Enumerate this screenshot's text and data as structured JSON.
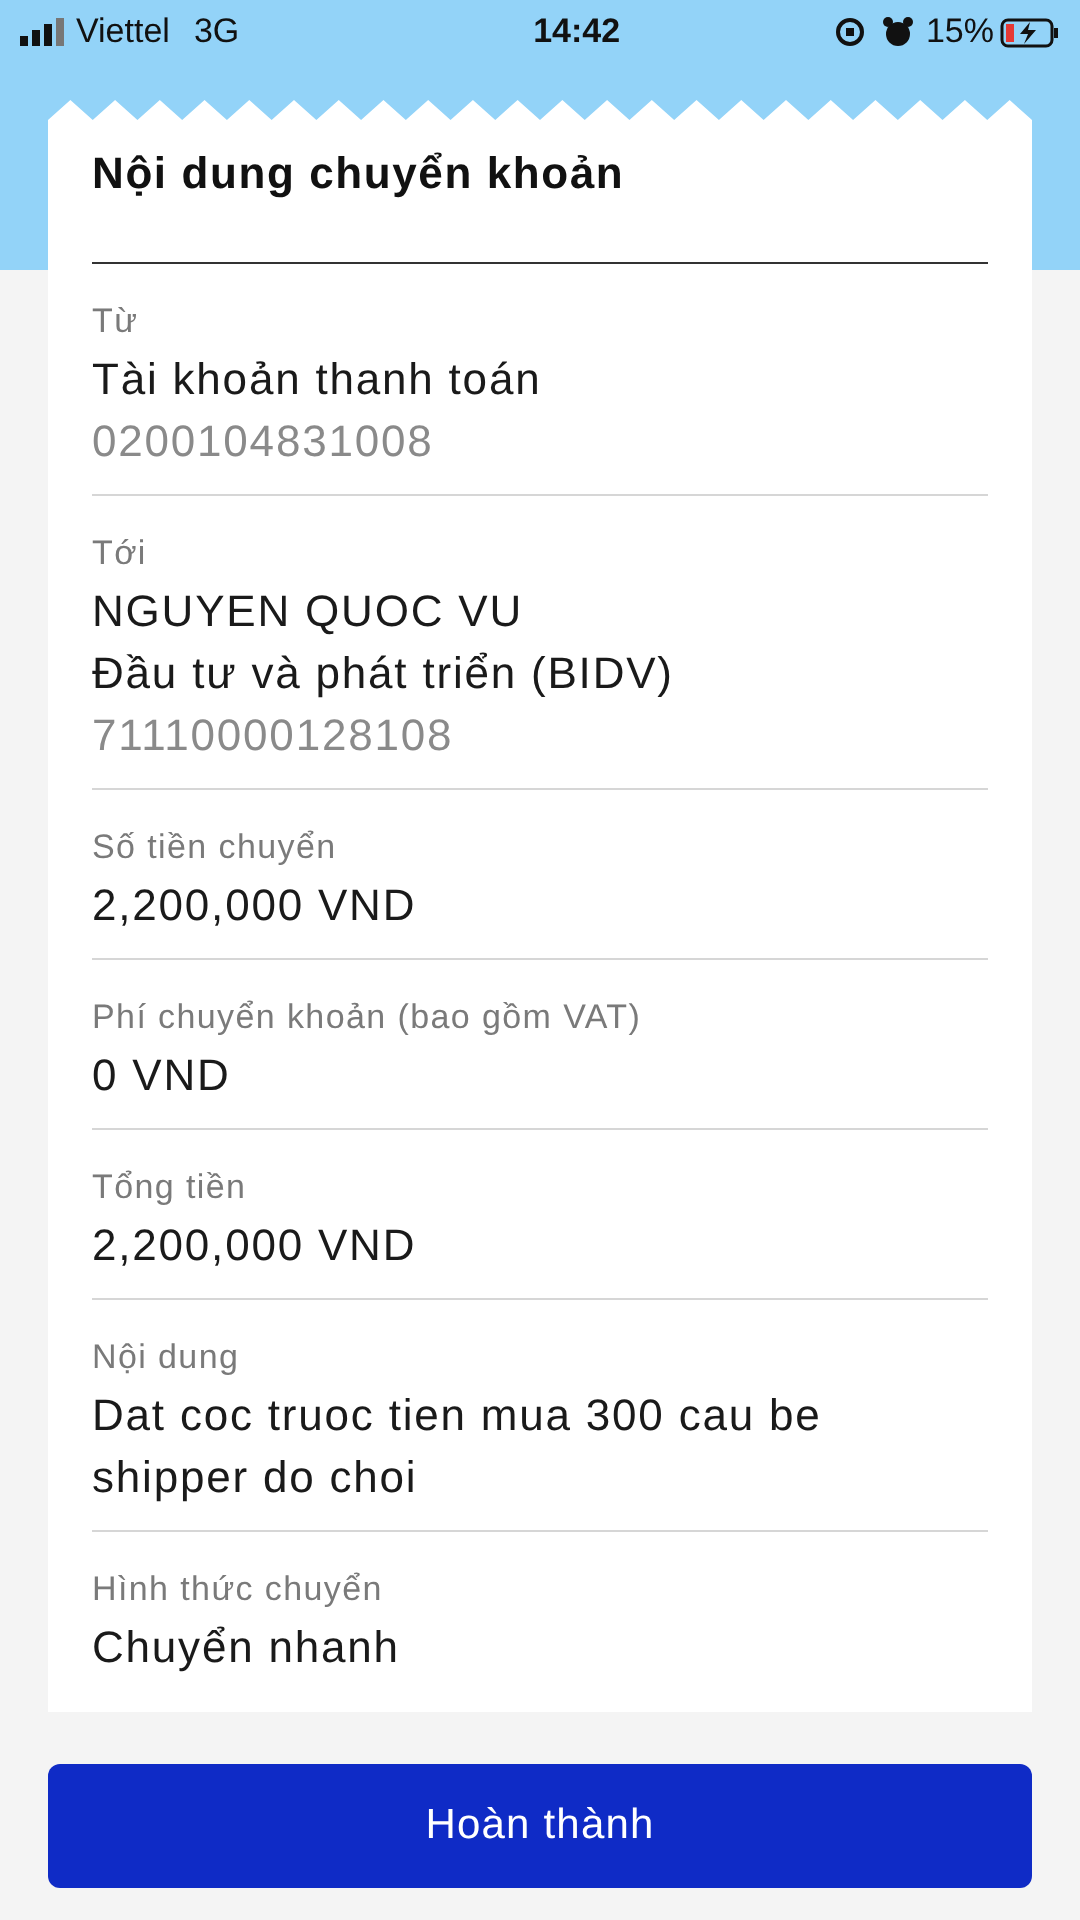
{
  "status_bar": {
    "carrier": "Viettel",
    "network": "3G",
    "time": "14:42",
    "battery": "15%"
  },
  "title": "Nội dung chuyển khoản",
  "sections": [
    {
      "label": "Từ",
      "lines": [
        {
          "text": "Tài khoản thanh toán",
          "kind": "primary"
        },
        {
          "text": "0200104831008",
          "kind": "secondary"
        }
      ]
    },
    {
      "label": "Tới",
      "lines": [
        {
          "text": "NGUYEN QUOC VU",
          "kind": "primary"
        },
        {
          "text": "Đầu tư và phát triển (BIDV)",
          "kind": "primary"
        },
        {
          "text": "71110000128108",
          "kind": "secondary"
        }
      ]
    },
    {
      "label": "Số tiền chuyển",
      "lines": [
        {
          "text": "2,200,000 VND",
          "kind": "primary"
        }
      ]
    },
    {
      "label": "Phí chuyển khoản (bao gồm VAT)",
      "lines": [
        {
          "text": "0 VND",
          "kind": "primary"
        }
      ]
    },
    {
      "label": "Tổng tiền",
      "lines": [
        {
          "text": "2,200,000 VND",
          "kind": "primary"
        }
      ]
    },
    {
      "label": "Nội dung",
      "lines": [
        {
          "text": "Dat coc truoc tien mua 300 cau be shipper do choi",
          "kind": "primary"
        }
      ]
    },
    {
      "label": "Hình thức chuyển",
      "lines": [
        {
          "text": "Chuyển nhanh",
          "kind": "primary"
        }
      ]
    }
  ],
  "button": "Hoàn thành"
}
